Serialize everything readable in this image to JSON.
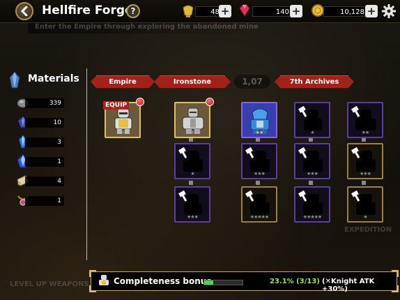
{
  "header": {
    "title": "Hellfire Forge",
    "help": "?",
    "resources": [
      {
        "name": "gold-pot",
        "value": "48"
      },
      {
        "name": "gem",
        "value": "140"
      },
      {
        "name": "coin",
        "value": "10,128"
      }
    ],
    "plus": "+"
  },
  "background": {
    "banner": "Enter the Empire through exploring the abandoned mine",
    "count": "1,07",
    "level_up": "LEVEL UP WEAPONS",
    "expedition": "EXPEDITION"
  },
  "materials": {
    "title": "Materials",
    "items": [
      {
        "icon": "stone-icon",
        "count": "339"
      },
      {
        "icon": "dark-crystal-icon",
        "count": "10"
      },
      {
        "icon": "blue-crystal-icon",
        "count": "3"
      },
      {
        "icon": "sapphire-icon",
        "count": "1"
      },
      {
        "icon": "scroll-icon",
        "count": "4"
      },
      {
        "icon": "amulet-icon",
        "count": "1"
      }
    ]
  },
  "categories": [
    "Empire",
    "Ironstone",
    "7th Archives"
  ],
  "equip_label": "EQUIP",
  "slots": [
    {
      "id": "empire-armor",
      "type": "gold-bright",
      "stars": "★",
      "star_style": "gray",
      "owned": true,
      "badge": true
    },
    {
      "id": "ironstone-armor",
      "type": "gold-bright",
      "stars": "★",
      "star_style": "gray",
      "owned": true,
      "badge": true
    },
    {
      "id": "ironstone-2",
      "type": "purple",
      "stars": "★",
      "star_style": "gray"
    },
    {
      "id": "ironstone-3",
      "type": "purple",
      "stars": "★★★",
      "star_style": "gray"
    },
    {
      "id": "archives-1",
      "type": "purple-bright",
      "stars": "★★",
      "star_style": "gold",
      "owned": true
    },
    {
      "id": "archives-2",
      "type": "purple",
      "stars": "★",
      "star_style": "gray"
    },
    {
      "id": "archives-3",
      "type": "purple",
      "stars": "★★",
      "star_style": "gray"
    },
    {
      "id": "archives-4",
      "type": "purple",
      "stars": "★★★",
      "star_style": "gray"
    },
    {
      "id": "archives-5",
      "type": "purple",
      "stars": "★★★",
      "star_style": "gray"
    },
    {
      "id": "archives-6",
      "type": "gold",
      "stars": "★★★",
      "star_style": "gray"
    },
    {
      "id": "archives-7",
      "type": "gold",
      "stars": "★★★★★",
      "star_style": "gray"
    },
    {
      "id": "archives-8",
      "type": "purple",
      "stars": "★★★★★",
      "star_style": "gray"
    },
    {
      "id": "archives-9",
      "type": "gold",
      "stars": "★",
      "star_style": "gray"
    }
  ],
  "completeness": {
    "label": "Completeness bonus",
    "progress_fraction": 0.231,
    "percent_text": "23.1% (3/13)",
    "bonus_text": "(✕Knight ATK +30%)"
  },
  "colors": {
    "ribbon": "#a0221a",
    "progress": "#4fd24f",
    "percent": "#9be84a"
  }
}
